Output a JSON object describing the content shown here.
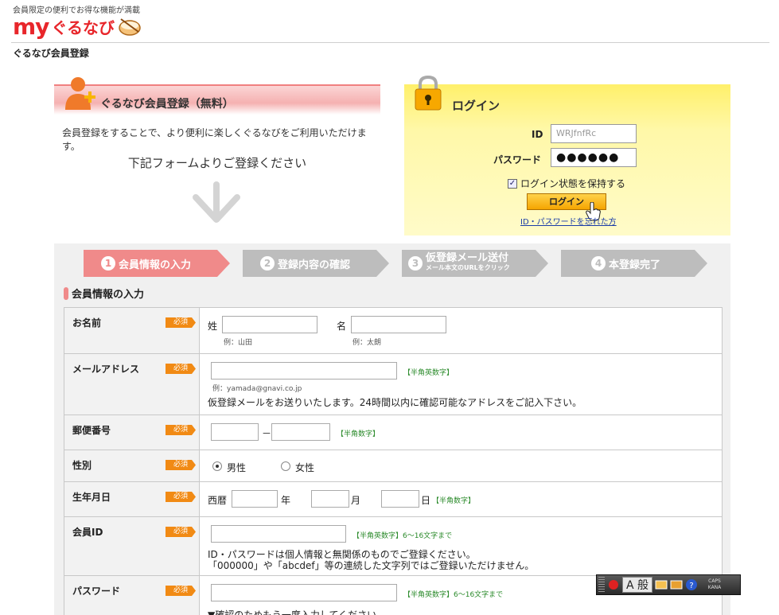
{
  "header": {
    "tagline": "会員限定の便利でお得な機能が満載",
    "logo_my": "my",
    "logo_gnavi": "ぐるなび",
    "page_title": "ぐるなび会員登録"
  },
  "register": {
    "title": "ぐるなび会員登録（無料）",
    "description": "会員登録をすることで、より便利に楽しくぐるなびをご利用いただけます。",
    "sub": "下記フォームよりご登録ください"
  },
  "login": {
    "title": "ログイン",
    "id_label": "ID",
    "id_value": "WRJfnfRc",
    "password_label": "パスワード",
    "password_value": "●●●●●●",
    "keep_label": "ログイン状態を保持する",
    "button": "ログイン",
    "forgot_link": "ID・パスワードを忘れた方"
  },
  "steps": [
    {
      "num": "1",
      "label": "会員情報の入力",
      "sub": ""
    },
    {
      "num": "2",
      "label": "登録内容の確認",
      "sub": ""
    },
    {
      "num": "3",
      "label": "仮登録メール送付",
      "sub": "メール本文のURLをクリック"
    },
    {
      "num": "4",
      "label": "本登録完了",
      "sub": ""
    }
  ],
  "section_title": "会員情報の入力",
  "required": "必須",
  "form": {
    "name": {
      "label": "お名前",
      "sei": "姓",
      "mei": "名",
      "sei_example": "例：山田",
      "mei_example": "例：太朗"
    },
    "email": {
      "label": "メールアドレス",
      "hint": "【半角英数字】",
      "example": "例：yamada@gnavi.co.jp",
      "note": "仮登録メールをお送りいたします。24時間以内に確認可能なアドレスをご記入下さい。"
    },
    "zip": {
      "label": "郵便番号",
      "dash": "－",
      "hint": "【半角数字】"
    },
    "gender": {
      "label": "性別",
      "male": "男性",
      "female": "女性"
    },
    "birth": {
      "label": "生年月日",
      "era": "西暦",
      "year": "年",
      "month": "月",
      "day": "日",
      "hint": "【半角数字】"
    },
    "member_id": {
      "label": "会員ID",
      "hint": "【半角英数字】6～16文字まで",
      "note1": "ID・パスワードは個人情報と無関係のものでご登録ください。",
      "note2": "「000000」や「abcdef」等の連続した文字列ではご登録いただけません。"
    },
    "password": {
      "label": "パスワード",
      "hint": "【半角英数字】6～16文字まで",
      "note": "▼確認のためもう一度入力してください。"
    }
  },
  "ime": {
    "mode": "A 般",
    "caps": "CAPS",
    "kana": "KANA"
  }
}
